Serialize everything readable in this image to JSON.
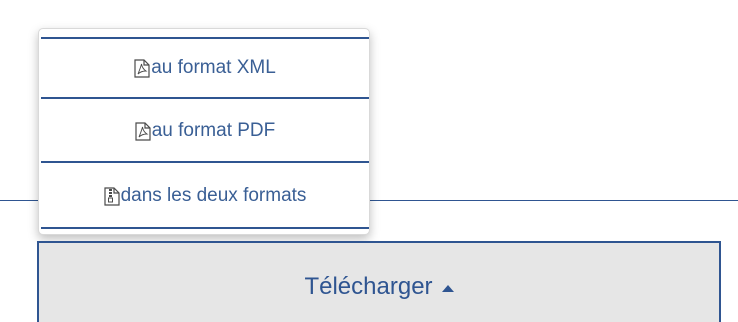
{
  "menu": {
    "items": [
      {
        "label": "au format XML",
        "icon": "pdf-file-icon"
      },
      {
        "label": "au format PDF",
        "icon": "pdf-file-icon"
      },
      {
        "label": "dans les deux formats",
        "icon": "archive-file-icon"
      }
    ]
  },
  "download": {
    "label": "Télécharger",
    "caret_icon": "caret-up-icon"
  },
  "colors": {
    "accent": "#2f5591",
    "button_bg": "#e6e6e6",
    "text": "#3a5f95"
  }
}
